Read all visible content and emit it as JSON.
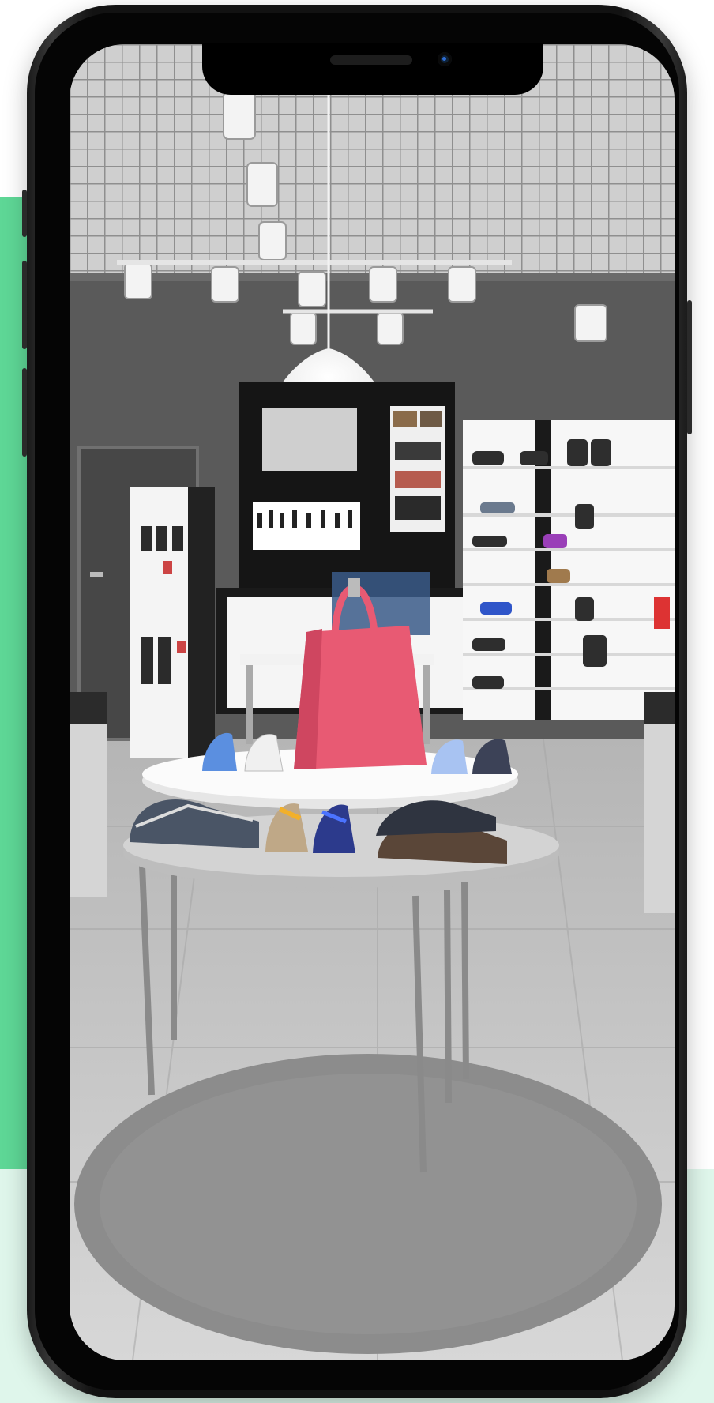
{
  "accent_colors": {
    "green": "#5ed796",
    "mint": "#dff6eb",
    "bag": "#e85a73"
  },
  "icons": [
    "phone-frame",
    "notch",
    "front-camera",
    "speaker-grille"
  ],
  "photo": {
    "subject": "shoe-store-interior"
  }
}
